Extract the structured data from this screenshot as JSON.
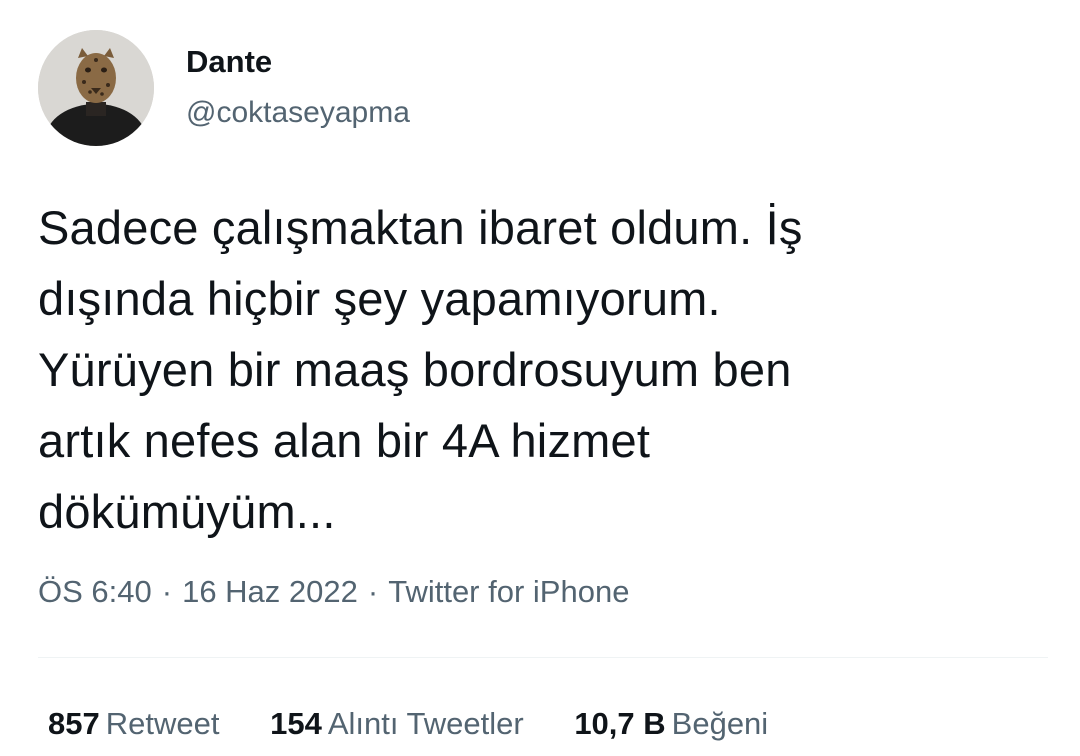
{
  "user": {
    "display_name": "Dante",
    "handle": "@coktaseyapma",
    "avatar_icon": "leopard-mask-avatar"
  },
  "tweet": {
    "lines": [
      "Sadece çalışmaktan ibaret oldum. İş",
      "dışında hiçbir şey yapamıyorum.",
      "Yürüyen bir maaş bordrosuyum ben",
      "artık nefes alan bir 4A hizmet",
      "dökümüyüm..."
    ]
  },
  "meta": {
    "time": "ÖS 6:40",
    "date": "16 Haz 2022",
    "source": "Twitter for iPhone",
    "separator": "·"
  },
  "stats": {
    "retweets": {
      "count": "857",
      "label": "Retweet"
    },
    "quotes": {
      "count": "154",
      "label": "Alıntı Tweetler"
    },
    "likes": {
      "count": "10,7 B",
      "label": "Beğeni"
    }
  },
  "colors": {
    "text_primary": "#0f1419",
    "text_secondary": "#536471",
    "divider": "#eff3f4"
  }
}
